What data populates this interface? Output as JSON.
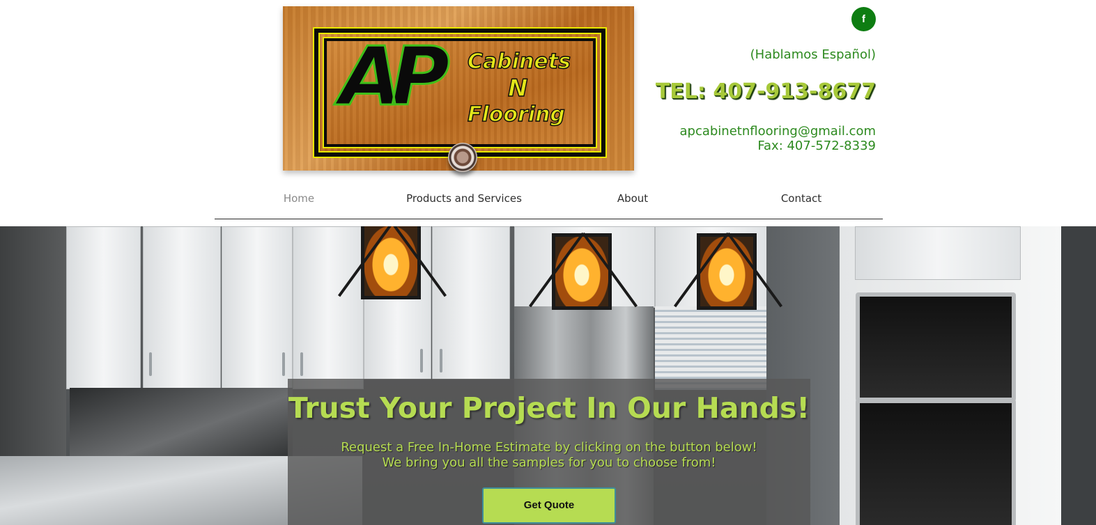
{
  "header": {
    "logo": {
      "initials": "AP",
      "word1": "Cabinets",
      "word2": "N",
      "word3": "Flooring"
    },
    "social": {
      "facebook_label": "f"
    },
    "spanish_note": "(Hablamos Español)",
    "phone": "TEL: 407-913-8677",
    "email": "apcabinetnflooring@gmail.com",
    "fax": "Fax: 407-572-8339"
  },
  "nav": {
    "items": [
      {
        "label": "Home",
        "active": true
      },
      {
        "label": "Products and Services",
        "active": false
      },
      {
        "label": "About",
        "active": false
      },
      {
        "label": "Contact",
        "active": false
      }
    ]
  },
  "hero": {
    "title": "Trust Your Project In Our Hands!",
    "subtitle_line1": "Request a Free In-Home Estimate by clicking on the button below!",
    "subtitle_line2": "We bring you all the samples for you to choose from!",
    "cta_label": "Get Quote"
  },
  "colors": {
    "brand_green": "#2d8a1f",
    "accent_lime": "#b6dc52",
    "facebook_bg": "#0e7d12"
  }
}
